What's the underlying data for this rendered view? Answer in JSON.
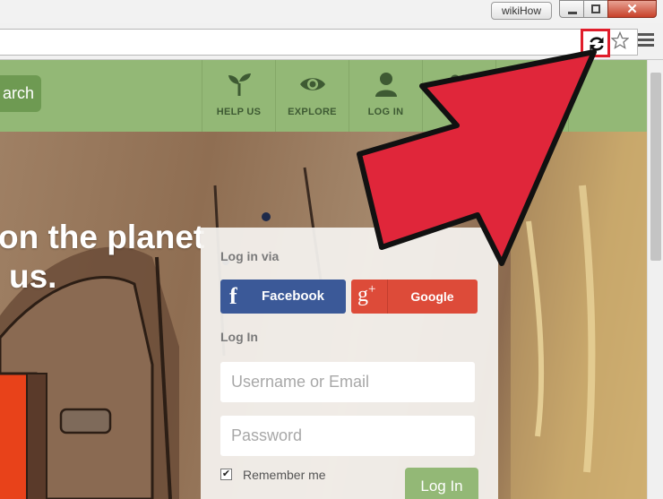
{
  "browser": {
    "profile_badge": "wikiHow",
    "close_glyph": "✕",
    "icons": [
      "reload-icon",
      "star-icon",
      "menu-icon"
    ],
    "highlight_color": "#e01d2b"
  },
  "nav": {
    "search_label": "arch",
    "items": [
      {
        "label": "HELP US",
        "icon": "sprout-icon"
      },
      {
        "label": "EXPLORE",
        "icon": "eye-icon"
      },
      {
        "label": "LOG IN",
        "icon": "person-icon"
      },
      {
        "label": "",
        "icon": "community-icon"
      }
    ]
  },
  "hero": {
    "headline_line1": "on the planet",
    "headline_line2": "us."
  },
  "login": {
    "via_label": "Log in via",
    "facebook_label": "Facebook",
    "google_label": "Google",
    "section_label": "Log In",
    "username_placeholder": "Username or Email",
    "password_placeholder": "Password",
    "remember_label": "Remember me",
    "remember_checked": true,
    "submit_label": "Log In"
  },
  "colors": {
    "nav_green": "#93b876",
    "facebook": "#3b5998",
    "google": "#dd4b39",
    "arrow_red": "#e0263a"
  }
}
